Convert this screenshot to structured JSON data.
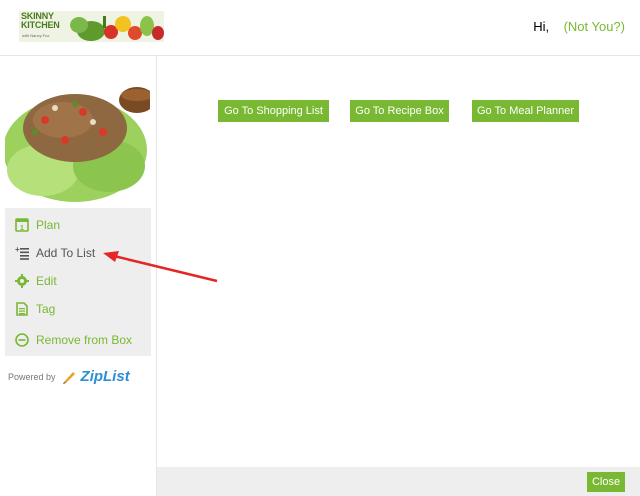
{
  "header": {
    "logo_line1": "SKINNY",
    "logo_line2": "KITCHEN",
    "logo_tagline": "with Nancy Fox",
    "greeting": "Hi,",
    "not_you": "(Not You?)"
  },
  "sidebar": {
    "items": [
      {
        "label": "Plan",
        "icon": "calendar-icon"
      },
      {
        "label": "Add To List",
        "icon": "add-to-list-icon"
      },
      {
        "label": "Edit",
        "icon": "gear-icon"
      },
      {
        "label": "Tag",
        "icon": "document-icon"
      },
      {
        "label": "Remove from Box",
        "icon": "minus-circle-icon"
      }
    ],
    "powered_by": "Powered by",
    "ziplist": "ZipList"
  },
  "main": {
    "buttons": [
      {
        "label": "Go To Shopping List"
      },
      {
        "label": "Go To Recipe Box"
      },
      {
        "label": "Go To Meal Planner"
      }
    ]
  },
  "footer": {
    "close_label": "Close"
  },
  "colors": {
    "accent": "#78b832",
    "arrow": "#e32626",
    "panel": "#eeeeee"
  }
}
